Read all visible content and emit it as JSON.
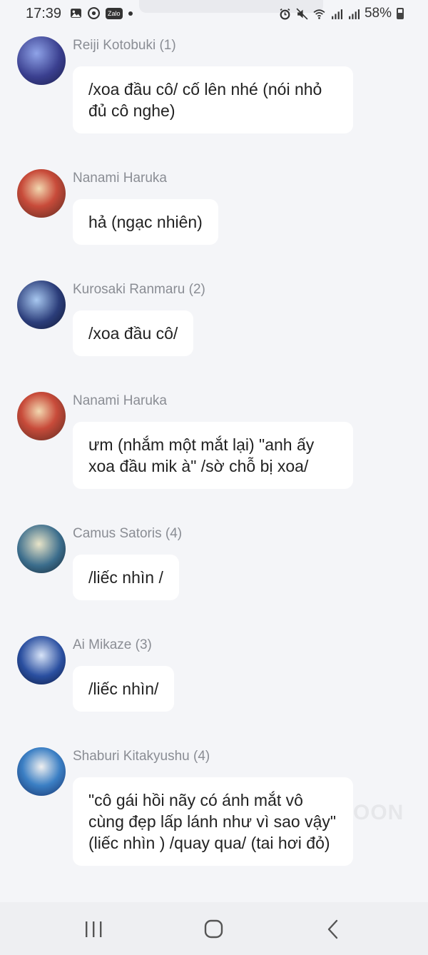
{
  "status_bar": {
    "time": "17:39",
    "zalo_label": "Zalo",
    "battery": "58%"
  },
  "messages": [
    {
      "sender": "Reiji Kotobuki (1)",
      "text": "/xoa đầu cô/ cố lên nhé (nói nhỏ đủ cô nghe)",
      "avatar_color": "#3a3f8f"
    },
    {
      "sender": "Nanami Haruka",
      "text": "hả (ngạc nhiên)",
      "avatar_color": "#c84b3a"
    },
    {
      "sender": "Kurosaki Ranmaru (2)",
      "text": "/xoa đầu cô/",
      "avatar_color": "#2b3d7a"
    },
    {
      "sender": "Nanami Haruka",
      "text": "ưm (nhắm một mắt lại) \"anh ấy xoa đầu mik à\" /sờ chỗ bị xoa/",
      "avatar_color": "#c84b3a"
    },
    {
      "sender": "Camus Satoris (4)",
      "text": "/liếc nhìn /",
      "avatar_color": "#3b6d8c"
    },
    {
      "sender": "Ai Mikaze (3)",
      "text": "/liếc nhìn/",
      "avatar_color": "#2a4fa0"
    },
    {
      "sender": "Shaburi Kitakyushu (4)",
      "text": "\"cô gái hồi nãy có ánh mắt vô cùng đẹp lấp lánh như vì sao vậy\" (liếc nhìn ) /quay qua/ (tai hơi đỏ)",
      "avatar_color": "#3b7fc4"
    }
  ],
  "watermark": "OON"
}
